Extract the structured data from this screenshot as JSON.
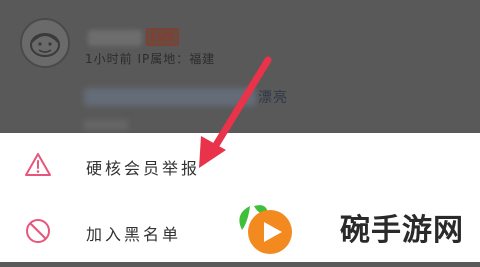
{
  "background": {
    "level_badge": "LV5",
    "meta_line": "1小时前 IP属地：福建",
    "comment_tail": "漂亮"
  },
  "sheet": {
    "items": [
      {
        "label": "硬核会员举报",
        "icon": "warning-triangle-icon"
      },
      {
        "label": "加入黑名单",
        "icon": "block-icon"
      }
    ]
  },
  "watermark": {
    "text": "碗手游网"
  },
  "colors": {
    "accent_red": "#e8334a",
    "icon_pink": "#e8567a",
    "watermark_orange": "#f28a1f",
    "watermark_green": "#3fbf3a"
  }
}
